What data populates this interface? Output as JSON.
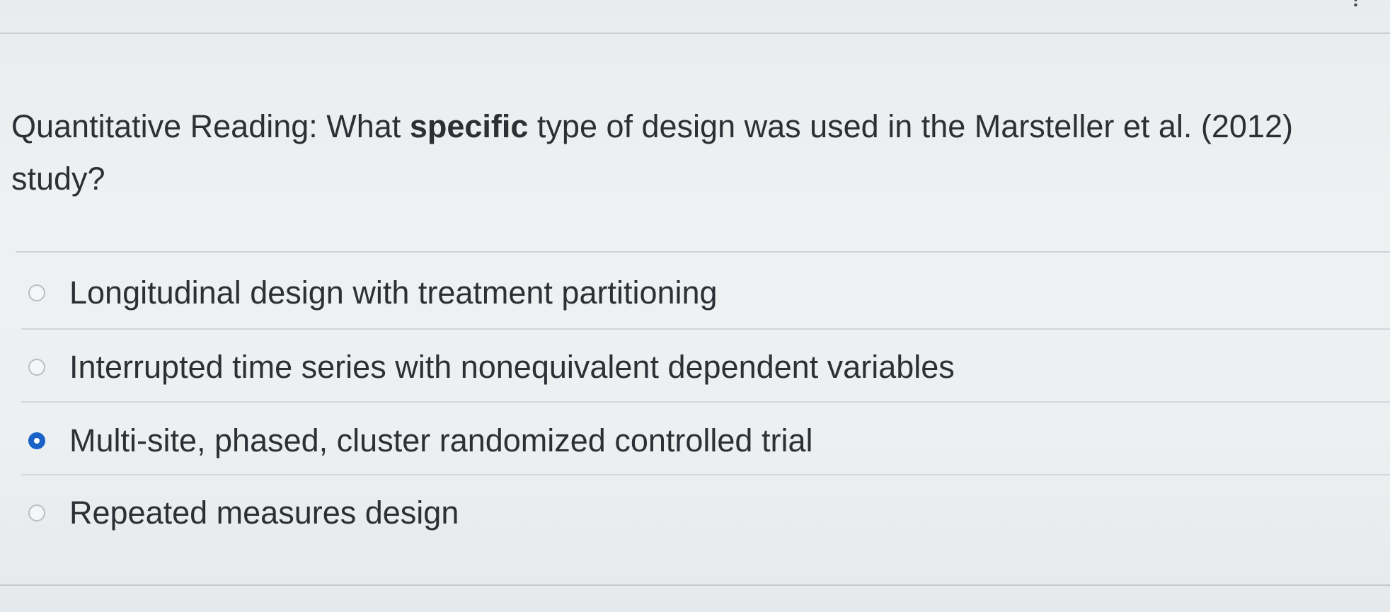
{
  "top": {
    "glyph": "?"
  },
  "question": {
    "prefix": "Quantitative Reading: What ",
    "emphasis": "specific",
    "suffix": " type of design was used in the Marsteller et al. (2012) study?"
  },
  "options": [
    {
      "label": "Longitudinal design with treatment partitioning",
      "selected": false
    },
    {
      "label": "Interrupted time series with nonequivalent dependent variables",
      "selected": false
    },
    {
      "label": "Multi-site, phased, cluster randomized controlled trial",
      "selected": true
    },
    {
      "label": "Repeated measures design",
      "selected": false
    }
  ],
  "colors": {
    "accent": "#1a62c7",
    "text": "#2c3035",
    "background": "#eceff1"
  }
}
